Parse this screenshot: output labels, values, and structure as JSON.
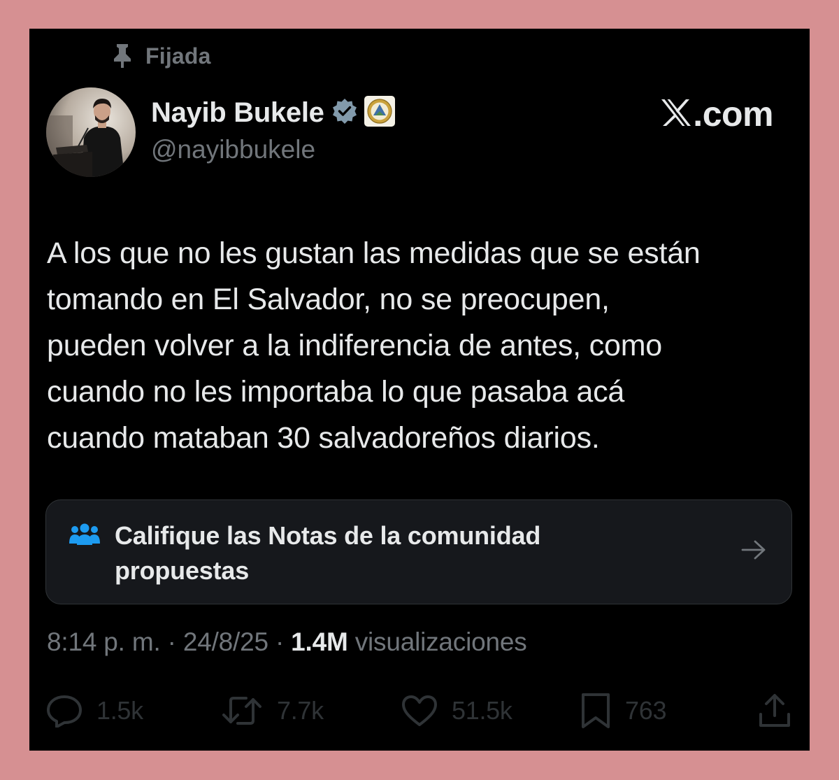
{
  "pinned": {
    "label": "Fijada",
    "icon": "pin-icon"
  },
  "author": {
    "name": "Nayib Bukele",
    "handle": "@nayibbukele",
    "verified_icon": "verified-badge-icon",
    "affiliate_icon": "el-salvador-seal-badge"
  },
  "brand": {
    "logo": "x-logo-icon",
    "domain": ".com"
  },
  "tweet": {
    "lines": [
      "A los que no les gustan las medidas que se están",
      "tomando en El Salvador, no se preocupen,",
      "pueden volver a la indiferencia de antes, como",
      "cuando no les importaba lo que pasaba acá",
      "cuando mataban 30 salvadoreños diarios."
    ]
  },
  "community_notes": {
    "icon": "people-icon",
    "lines": [
      "Califique las Notas de la comunidad",
      "propuestas"
    ],
    "arrow_icon": "arrow-right-icon"
  },
  "meta": {
    "time": "8:14 p. m.",
    "separator": " · ",
    "date": "24/8/25",
    "views_count": "1.4M",
    "views_label": " visualizaciones"
  },
  "actions": {
    "reply": {
      "icon": "reply-icon",
      "count": "1.5k"
    },
    "repost": {
      "icon": "repost-icon",
      "count": "7.7k"
    },
    "like": {
      "icon": "heart-icon",
      "count": "51.5k"
    },
    "bookmark": {
      "icon": "bookmark-icon",
      "count": "763"
    },
    "share": {
      "icon": "share-icon"
    }
  },
  "colors": {
    "frame": "#d69092",
    "background": "#000000",
    "text_primary": "#e7e9ea",
    "text_secondary": "#71767b",
    "action_muted": "#2f3336",
    "notes_accent": "#1d9bf0",
    "notes_background": "#16181c"
  }
}
